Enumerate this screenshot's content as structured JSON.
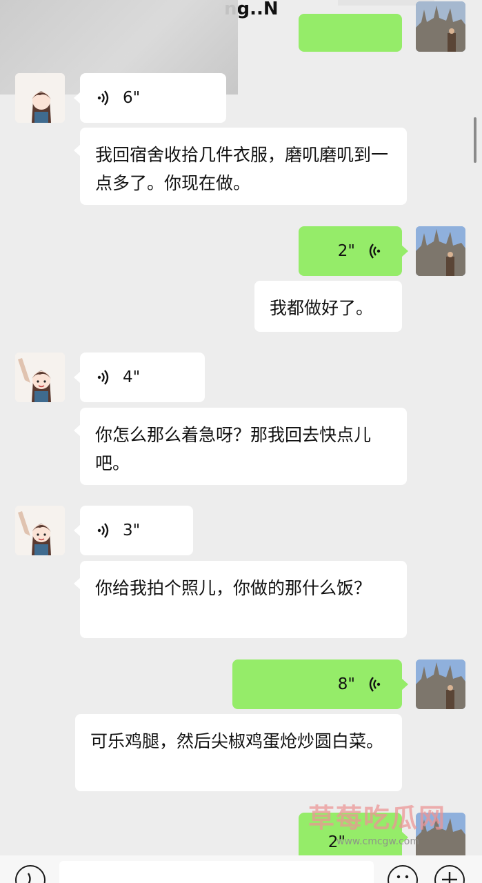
{
  "header": {
    "title": "ng..N",
    "more_icon": "more-dots-icon"
  },
  "messages": [
    {
      "side": "left",
      "kind": "voice",
      "duration": "6\""
    },
    {
      "side": "left",
      "kind": "text",
      "text": "我回宿舍收拾几件衣服，磨叽磨叽到一点多了。你现在做。"
    },
    {
      "side": "right",
      "kind": "voice",
      "duration": "2\""
    },
    {
      "side": "right",
      "kind": "text",
      "text": "我都做好了。"
    },
    {
      "side": "left",
      "kind": "voice",
      "duration": "4\""
    },
    {
      "side": "left",
      "kind": "text",
      "text": "你怎么那么着急呀？那我回去快点儿吧。"
    },
    {
      "side": "left",
      "kind": "voice",
      "duration": "3\""
    },
    {
      "side": "left",
      "kind": "text",
      "text": "你给我拍个照儿，你做的那什么饭？"
    },
    {
      "side": "right",
      "kind": "voice",
      "duration": "8\""
    },
    {
      "side": "right",
      "kind": "text",
      "text": "可乐鸡腿，然后尖椒鸡蛋炝炒圆白菜。"
    },
    {
      "side": "right",
      "kind": "voice",
      "duration": "2\""
    }
  ],
  "watermark": {
    "text": "草莓吃瓜网",
    "url": "www.cmcgw.com"
  },
  "colors": {
    "background": "#ededed",
    "outgoing_bubble": "#95ec69",
    "incoming_bubble": "#ffffff",
    "watermark": "#eb9696"
  },
  "icons": {
    "voice_wave": "voice-wave-icon",
    "voice_input": "voice-input-icon",
    "emoji": "emoji-icon",
    "add": "add-icon"
  }
}
